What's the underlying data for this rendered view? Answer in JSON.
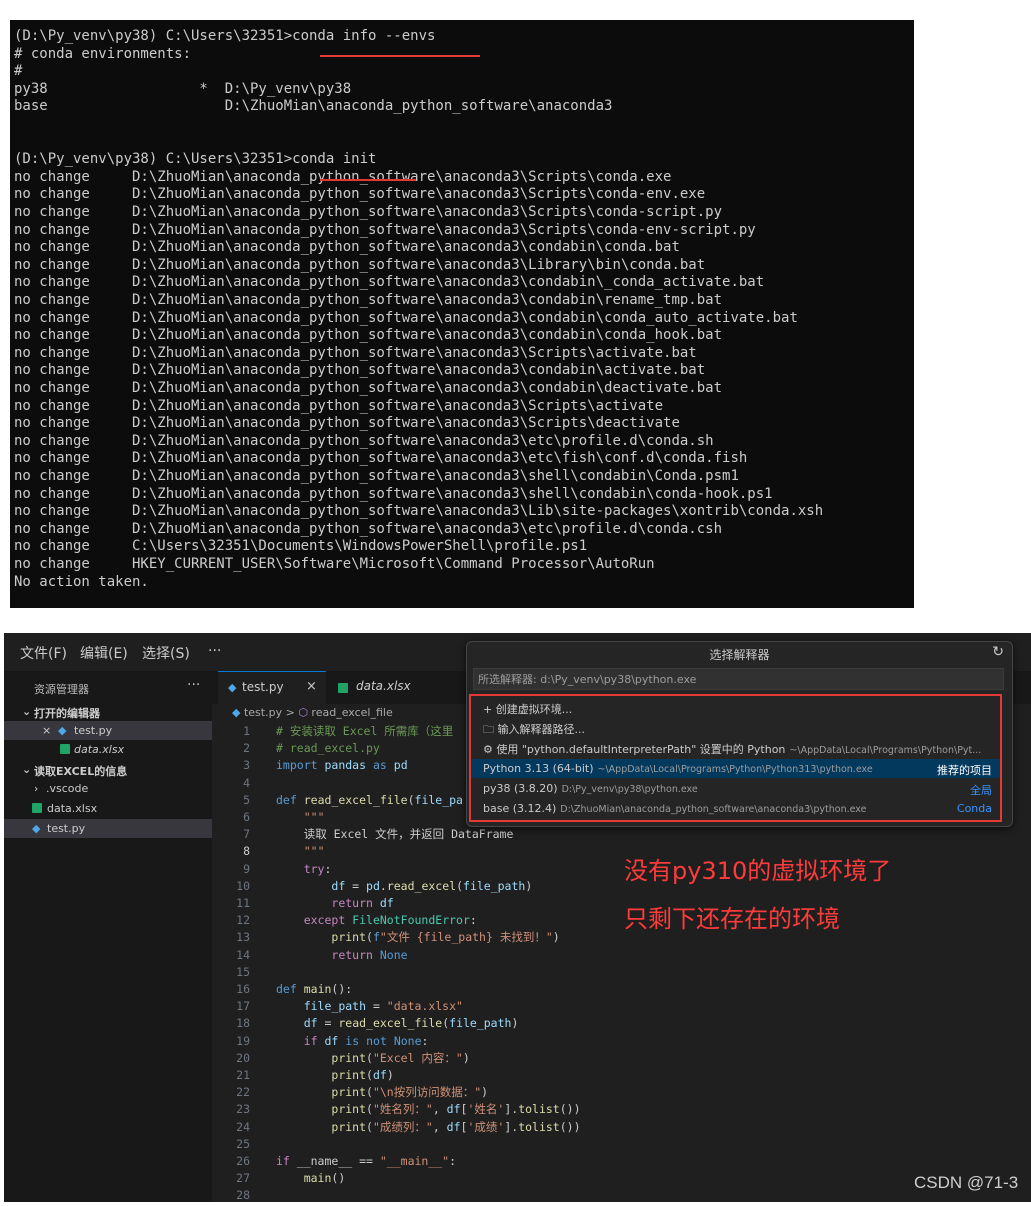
{
  "terminal": {
    "lines": [
      "(D:\\Py_venv\\py38) C:\\Users\\32351>conda info --envs",
      "# conda environments:",
      "#",
      "py38                  *  D:\\Py_venv\\py38",
      "base                     D:\\ZhuoMian\\anaconda_python_software\\anaconda3",
      "",
      "",
      "(D:\\Py_venv\\py38) C:\\Users\\32351>conda init",
      "no change     D:\\ZhuoMian\\anaconda_python_software\\anaconda3\\Scripts\\conda.exe",
      "no change     D:\\ZhuoMian\\anaconda_python_software\\anaconda3\\Scripts\\conda-env.exe",
      "no change     D:\\ZhuoMian\\anaconda_python_software\\anaconda3\\Scripts\\conda-script.py",
      "no change     D:\\ZhuoMian\\anaconda_python_software\\anaconda3\\Scripts\\conda-env-script.py",
      "no change     D:\\ZhuoMian\\anaconda_python_software\\anaconda3\\condabin\\conda.bat",
      "no change     D:\\ZhuoMian\\anaconda_python_software\\anaconda3\\Library\\bin\\conda.bat",
      "no change     D:\\ZhuoMian\\anaconda_python_software\\anaconda3\\condabin\\_conda_activate.bat",
      "no change     D:\\ZhuoMian\\anaconda_python_software\\anaconda3\\condabin\\rename_tmp.bat",
      "no change     D:\\ZhuoMian\\anaconda_python_software\\anaconda3\\condabin\\conda_auto_activate.bat",
      "no change     D:\\ZhuoMian\\anaconda_python_software\\anaconda3\\condabin\\conda_hook.bat",
      "no change     D:\\ZhuoMian\\anaconda_python_software\\anaconda3\\Scripts\\activate.bat",
      "no change     D:\\ZhuoMian\\anaconda_python_software\\anaconda3\\condabin\\activate.bat",
      "no change     D:\\ZhuoMian\\anaconda_python_software\\anaconda3\\condabin\\deactivate.bat",
      "no change     D:\\ZhuoMian\\anaconda_python_software\\anaconda3\\Scripts\\activate",
      "no change     D:\\ZhuoMian\\anaconda_python_software\\anaconda3\\Scripts\\deactivate",
      "no change     D:\\ZhuoMian\\anaconda_python_software\\anaconda3\\etc\\profile.d\\conda.sh",
      "no change     D:\\ZhuoMian\\anaconda_python_software\\anaconda3\\etc\\fish\\conf.d\\conda.fish",
      "no change     D:\\ZhuoMian\\anaconda_python_software\\anaconda3\\shell\\condabin\\Conda.psm1",
      "no change     D:\\ZhuoMian\\anaconda_python_software\\anaconda3\\shell\\condabin\\conda-hook.ps1",
      "no change     D:\\ZhuoMian\\anaconda_python_software\\anaconda3\\Lib\\site-packages\\xontrib\\conda.xsh",
      "no change     D:\\ZhuoMian\\anaconda_python_software\\anaconda3\\etc\\profile.d\\conda.csh",
      "no change     C:\\Users\\32351\\Documents\\WindowsPowerShell\\profile.ps1",
      "no change     HKEY_CURRENT_USER\\Software\\Microsoft\\Command Processor\\AutoRun",
      "No action taken."
    ]
  },
  "vscode": {
    "menu": [
      "文件(F)",
      "编辑(E)",
      "选择(S)",
      "···"
    ],
    "sidebar": {
      "title": "资源管理器",
      "more": "···",
      "open_editors_header": "打开的编辑器",
      "open_editors": [
        {
          "prefix": "×",
          "name": "test.py"
        },
        {
          "name": "data.xlsx"
        }
      ],
      "folder_header": "读取EXCEL的信息",
      "files": [
        ".vscode",
        "data.xlsx",
        "test.py"
      ]
    },
    "tabs": [
      {
        "name": "test.py",
        "close": "×"
      },
      {
        "name": "data.xlsx"
      }
    ],
    "breadcrumb": {
      "file": "test.py",
      "sep": ">",
      "symbol": "read_excel_file"
    },
    "quick_pick": {
      "title": "选择解释器",
      "refresh_icon": "↻",
      "placeholder": "所选解释器: d:\\Py_venv\\py38\\python.exe",
      "items": [
        {
          "icon": "+",
          "label": "创建虚拟环境...",
          "desc": "",
          "right": ""
        },
        {
          "icon": "🗀",
          "label": "输入解释器路径...",
          "desc": "",
          "right": ""
        },
        {
          "icon": "⚙",
          "label": "使用 \\\"python.defaultInterpreterPath\\\" 设置中的 Python",
          "desc": "~\\AppData\\Local\\Programs\\Python\\Pyt...",
          "right": ""
        },
        {
          "icon": "",
          "label": "Python 3.13 (64-bit)",
          "desc": "~\\AppData\\Local\\Programs\\Python\\Python313\\python.exe",
          "right": "推荐的项目"
        },
        {
          "icon": "",
          "label": "py38 (3.8.20)",
          "desc": "D:\\Py_venv\\py38\\python.exe",
          "right": "全局"
        },
        {
          "icon": "",
          "label": "base (3.12.4)",
          "desc": "D:\\ZhuoMian\\anaconda_python_software\\anaconda3\\python.exe",
          "right": "Conda"
        }
      ]
    },
    "code_lines": [
      "# 安装读取 Excel 所需库（这里",
      "# read_excel.py",
      "import pandas as pd",
      "",
      "def read_excel_file(file_pa",
      "    \"\"\"",
      "    读取 Excel 文件，并返回 DataFrame",
      "    \"\"\"",
      "    try:",
      "        df = pd.read_excel(file_path)",
      "        return df",
      "    except FileNotFoundError:",
      "        print(f\"文件 {file_path} 未找到！\")",
      "        return None",
      "",
      "def main():",
      "    file_path = \"data.xlsx\"",
      "    df = read_excel_file(file_path)",
      "    if df is not None:",
      "        print(\"Excel 内容：\")",
      "        print(df)",
      "        print(\"\\n按列访问数据：\")",
      "        print(\"姓名列：\", df['姓名'].tolist())",
      "        print(\"成绩列：\", df['成绩'].tolist())",
      "",
      "if __name__ == \"__main__\":",
      "    main()",
      ""
    ],
    "current_line": 8
  },
  "annotation": {
    "line1": "没有py310的虚拟环境了",
    "line2": "只剩下还存在的环境"
  },
  "watermark": "CSDN @71-3",
  "colors": {
    "terminal_bg": "#0c0c0c",
    "editor_bg": "#1f1f1f",
    "highlight_red": "#e53935",
    "selection_blue": "#04395e"
  }
}
